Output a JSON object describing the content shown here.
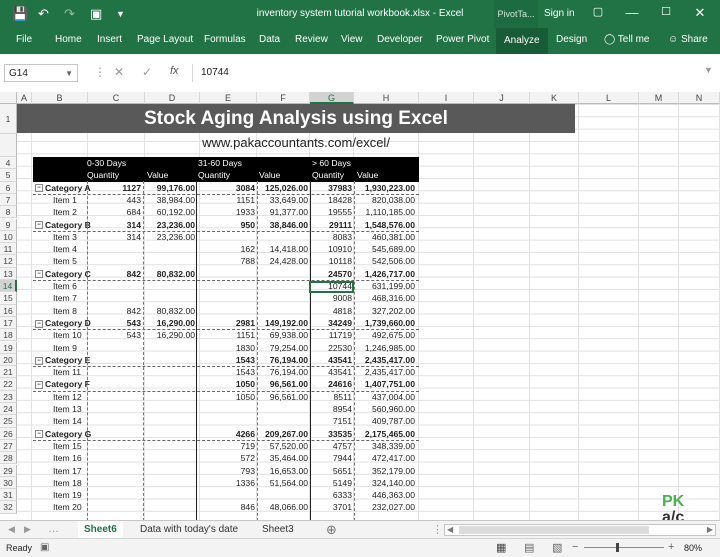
{
  "window": {
    "title": "inventory system tutorial workbook.xlsx - Excel",
    "context_tab": "PivotTa...",
    "sign_in": "Sign in"
  },
  "ribbon_tabs": [
    "File",
    "Home",
    "Insert",
    "Page Layout",
    "Formulas",
    "Data",
    "Review",
    "View",
    "Developer",
    "Power Pivot",
    "Analyze",
    "Design"
  ],
  "tell_me": "Tell me",
  "share": "Share",
  "formula_bar": {
    "name_box": "G14",
    "value": "10744",
    "fx": "fx"
  },
  "columns": [
    "A",
    "B",
    "C",
    "D",
    "E",
    "F",
    "G",
    "H",
    "I",
    "J",
    "K",
    "L",
    "M",
    "N"
  ],
  "rows": [
    "1",
    "4",
    "5",
    "6",
    "7",
    "8",
    "9",
    "10",
    "11",
    "12",
    "13",
    "14",
    "15",
    "16",
    "17",
    "18",
    "19",
    "20",
    "21",
    "22",
    "23",
    "24",
    "25",
    "26",
    "27",
    "28",
    "29",
    "30",
    "31",
    "32"
  ],
  "sheet_title": "Stock Aging Analysis using Excel",
  "sheet_url": "www.pakaccountants.com/excel/",
  "pivot": {
    "groups": [
      "0-30 Days",
      "31-60 Days",
      "> 60 Days"
    ],
    "subheaders": [
      "Quantity",
      "Value",
      "Quantity",
      "Value",
      "Quantity",
      "Value"
    ],
    "rows": [
      {
        "label": "Category A",
        "cat": true,
        "v": [
          "1127",
          "99,176.00",
          "3084",
          "125,026.00",
          "37983",
          "1,930,223.00"
        ]
      },
      {
        "label": "Item 1",
        "cat": false,
        "v": [
          "443",
          "38,984.00",
          "1151",
          "33,649.00",
          "18428",
          "820,038.00"
        ]
      },
      {
        "label": "Item 2",
        "cat": false,
        "v": [
          "684",
          "60,192.00",
          "1933",
          "91,377.00",
          "19555",
          "1,110,185.00"
        ]
      },
      {
        "label": "Category B",
        "cat": true,
        "v": [
          "314",
          "23,236.00",
          "950",
          "38,846.00",
          "29111",
          "1,548,576.00"
        ]
      },
      {
        "label": "Item 3",
        "cat": false,
        "v": [
          "314",
          "23,236.00",
          "",
          "",
          "8083",
          "460,381.00"
        ]
      },
      {
        "label": "Item 4",
        "cat": false,
        "v": [
          "",
          "",
          "162",
          "14,418.00",
          "10910",
          "545,689.00"
        ]
      },
      {
        "label": "Item 5",
        "cat": false,
        "v": [
          "",
          "",
          "788",
          "24,428.00",
          "10118",
          "542,506.00"
        ]
      },
      {
        "label": "Category C",
        "cat": true,
        "v": [
          "842",
          "80,832.00",
          "",
          "",
          "24570",
          "1,426,717.00"
        ]
      },
      {
        "label": "Item 6",
        "cat": false,
        "v": [
          "",
          "",
          "",
          "",
          "10744",
          "631,199.00"
        ]
      },
      {
        "label": "Item 7",
        "cat": false,
        "v": [
          "",
          "",
          "",
          "",
          "9008",
          "468,316.00"
        ]
      },
      {
        "label": "Item 8",
        "cat": false,
        "v": [
          "842",
          "80,832.00",
          "",
          "",
          "4818",
          "327,202.00"
        ]
      },
      {
        "label": "Category D",
        "cat": true,
        "v": [
          "543",
          "16,290.00",
          "2981",
          "149,192.00",
          "34249",
          "1,739,660.00"
        ]
      },
      {
        "label": "Item 10",
        "cat": false,
        "v": [
          "543",
          "16,290.00",
          "1151",
          "69,938.00",
          "11719",
          "492,675.00"
        ]
      },
      {
        "label": "Item 9",
        "cat": false,
        "v": [
          "",
          "",
          "1830",
          "79,254.00",
          "22530",
          "1,246,985.00"
        ]
      },
      {
        "label": "Category E",
        "cat": true,
        "v": [
          "",
          "",
          "1543",
          "76,194.00",
          "43541",
          "2,435,417.00"
        ]
      },
      {
        "label": "Item 11",
        "cat": false,
        "v": [
          "",
          "",
          "1543",
          "76,194.00",
          "43541",
          "2,435,417.00"
        ]
      },
      {
        "label": "Category F",
        "cat": true,
        "v": [
          "",
          "",
          "1050",
          "96,561.00",
          "24616",
          "1,407,751.00"
        ]
      },
      {
        "label": "Item 12",
        "cat": false,
        "v": [
          "",
          "",
          "1050",
          "96,561.00",
          "8511",
          "437,004.00"
        ]
      },
      {
        "label": "Item 13",
        "cat": false,
        "v": [
          "",
          "",
          "",
          "",
          "8954",
          "560,960.00"
        ]
      },
      {
        "label": "Item 14",
        "cat": false,
        "v": [
          "",
          "",
          "",
          "",
          "7151",
          "409,787.00"
        ]
      },
      {
        "label": "Category G",
        "cat": true,
        "v": [
          "",
          "",
          "4266",
          "209,267.00",
          "33535",
          "2,175,465.00"
        ]
      },
      {
        "label": "Item 15",
        "cat": false,
        "v": [
          "",
          "",
          "719",
          "57,520.00",
          "4757",
          "348,339.00"
        ]
      },
      {
        "label": "Item 16",
        "cat": false,
        "v": [
          "",
          "",
          "572",
          "35,464.00",
          "7944",
          "472,417.00"
        ]
      },
      {
        "label": "Item 17",
        "cat": false,
        "v": [
          "",
          "",
          "793",
          "16,653.00",
          "5651",
          "352,179.00"
        ]
      },
      {
        "label": "Item 18",
        "cat": false,
        "v": [
          "",
          "",
          "1336",
          "51,564.00",
          "5149",
          "324,140.00"
        ]
      },
      {
        "label": "Item 19",
        "cat": false,
        "v": [
          "",
          "",
          "",
          "",
          "6333",
          "446,363.00"
        ]
      },
      {
        "label": "Item 20",
        "cat": false,
        "v": [
          "",
          "",
          "846",
          "48,066.00",
          "3701",
          "232,027.00"
        ]
      }
    ]
  },
  "sheet_tabs": [
    "Sheet6",
    "Data with today's date",
    "Sheet3"
  ],
  "status": {
    "ready": "Ready",
    "zoom": "80%"
  },
  "logo": {
    "line1": "PK",
    "line2": "a/c"
  },
  "colors": {
    "excel_green": "#217346",
    "title_fill": "#595959"
  }
}
